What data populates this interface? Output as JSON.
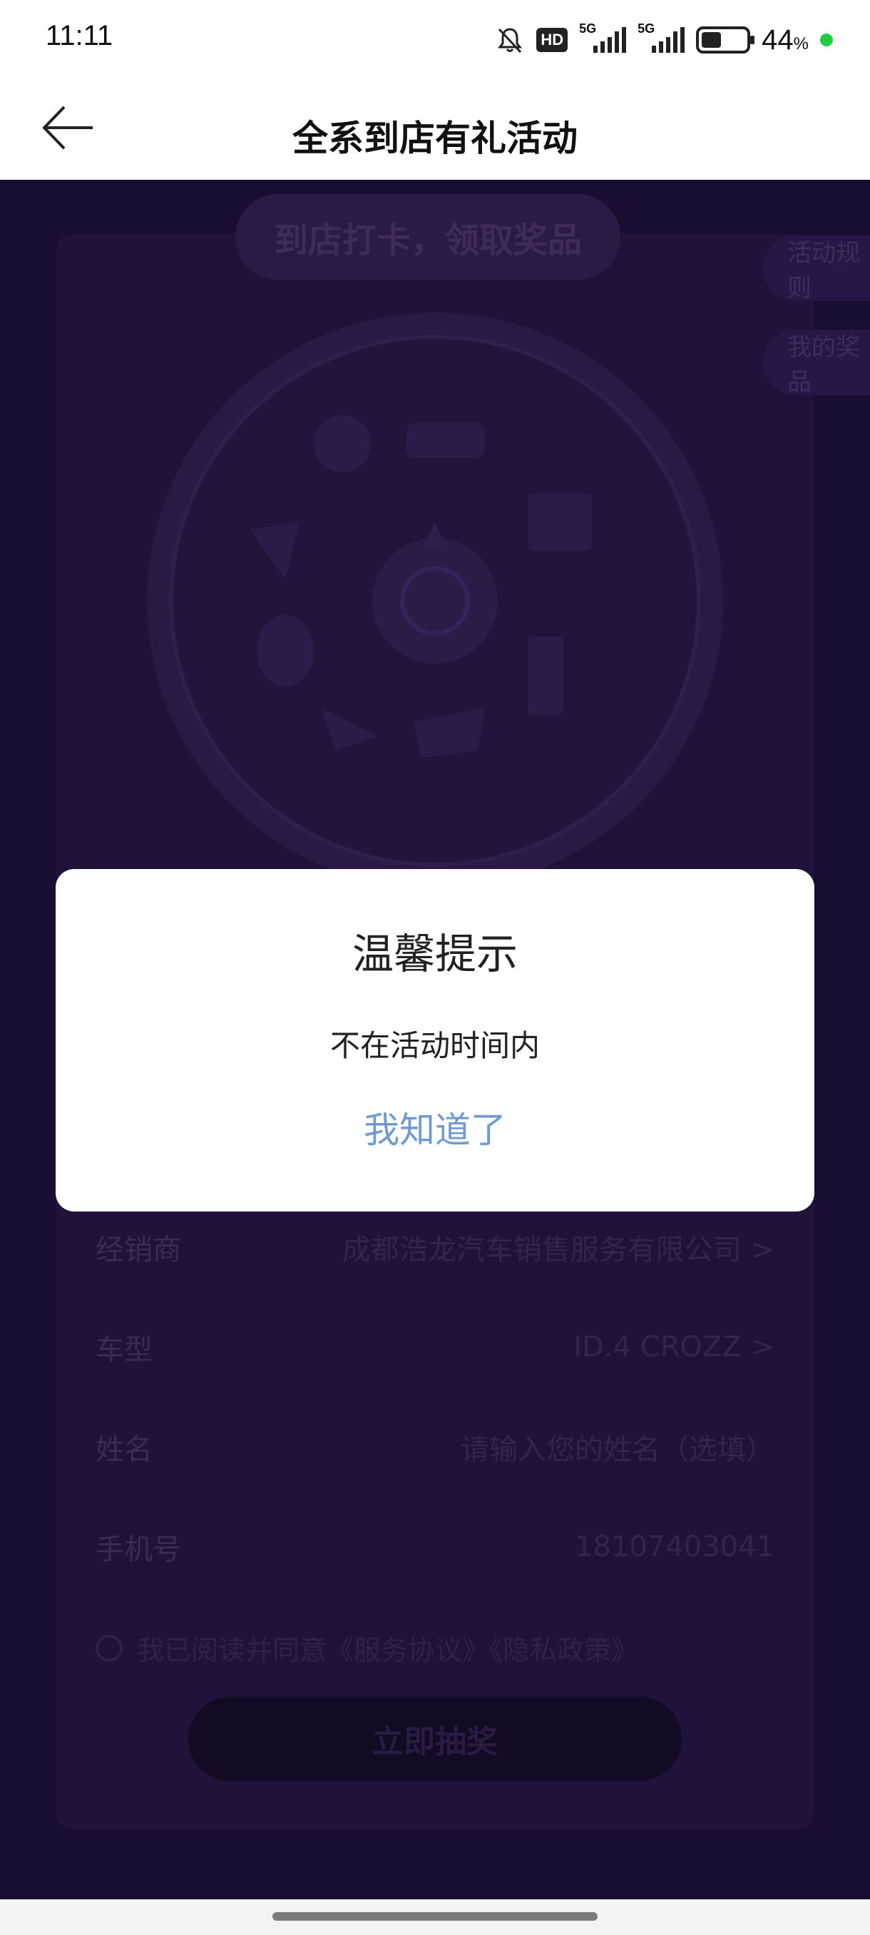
{
  "status_bar": {
    "time": "11:11",
    "hd_badge": "HD",
    "signal1_label": "5G",
    "signal2_label": "5G",
    "battery_percent": 44,
    "battery_text": "44",
    "battery_unit": "%",
    "charging_dot_color": "#22cc44",
    "icons": [
      "bell-muted-icon",
      "hd-icon",
      "signal-5g-icon",
      "signal-5g-icon",
      "battery-icon"
    ]
  },
  "header": {
    "title": "全系到店有礼活动",
    "back_icon": "arrow-left-icon"
  },
  "background": {
    "banner": "到店打卡，领取奖品",
    "side_tabs": [
      "活动规则",
      "我的奖品"
    ],
    "form": [
      {
        "label": "经销商",
        "value": "成都浩龙汽车销售服务有限公司 >"
      },
      {
        "label": "车型",
        "value": "ID.4 CROZZ >"
      },
      {
        "label": "姓名",
        "value": "请输入您的姓名（选填）"
      },
      {
        "label": "手机号",
        "value": "18107403041"
      }
    ],
    "agreement": "我已阅读并同意《服务协议》《隐私政策》",
    "draw_button": "立即抽奖"
  },
  "dialog": {
    "title": "温馨提示",
    "message": "不在活动时间内",
    "confirm": "我知道了",
    "confirm_color": "#6f9bd0"
  }
}
